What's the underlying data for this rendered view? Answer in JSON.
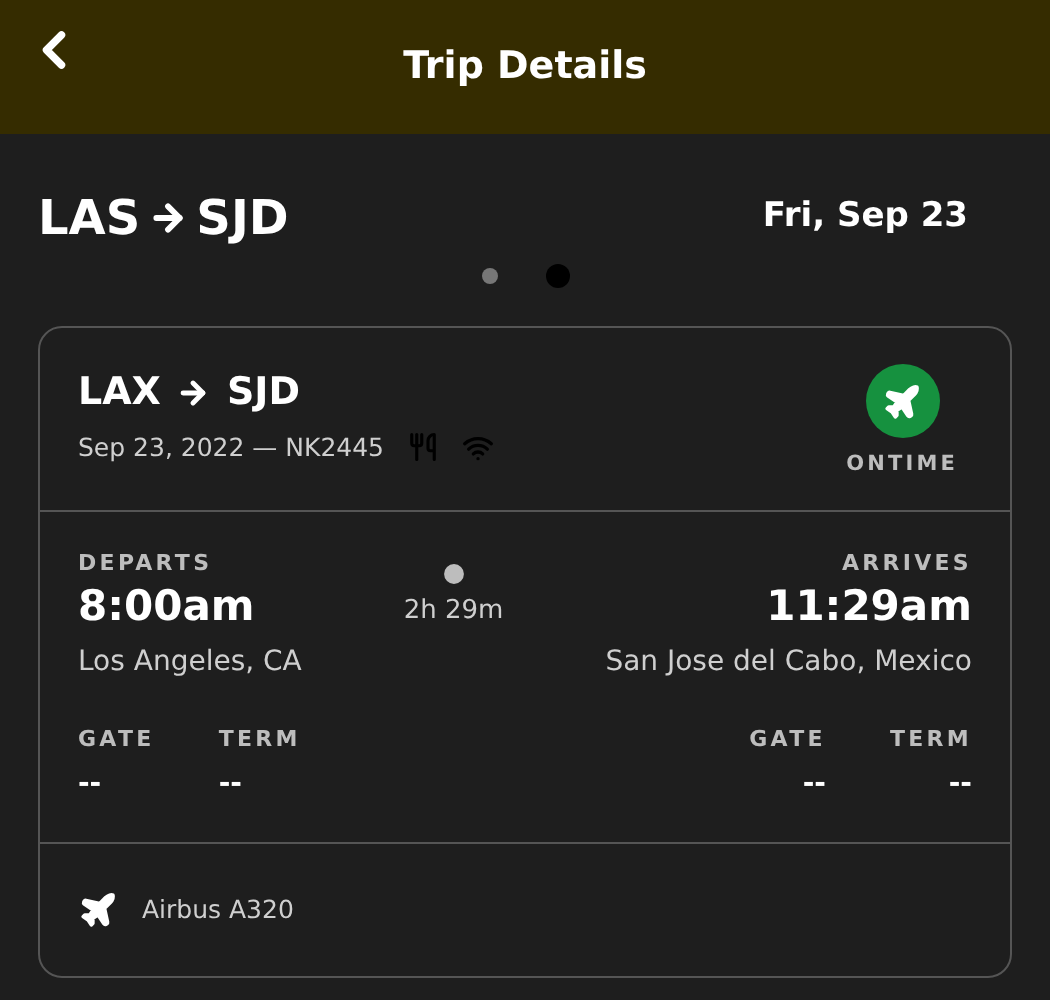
{
  "header": {
    "title": "Trip Details"
  },
  "trip": {
    "origin": "LAS",
    "destination": "SJD",
    "date": "Fri, Sep 23"
  },
  "pager": [
    {
      "selected": false
    },
    {
      "selected": true
    }
  ],
  "flight": {
    "origin": "LAX",
    "destination": "SJD",
    "info": "Sep 23, 2022 — NK2445",
    "amenities": [
      {
        "kind": "meal"
      },
      {
        "kind": "wifi"
      }
    ],
    "status": "ONTIME",
    "departs": {
      "label": "DEPARTS",
      "time": "8:00am",
      "city": "Los Angeles, CA",
      "gate_label": "GATE",
      "gate": "--",
      "term_label": "TERM",
      "term": "--"
    },
    "duration": "2h 29m",
    "arrives": {
      "label": "ARRIVES",
      "time": "11:29am",
      "city": "San Jose del Cabo, Mexico",
      "gate_label": "GATE",
      "gate": "--",
      "term_label": "TERM",
      "term": "--"
    },
    "aircraft": "Airbus A320"
  }
}
